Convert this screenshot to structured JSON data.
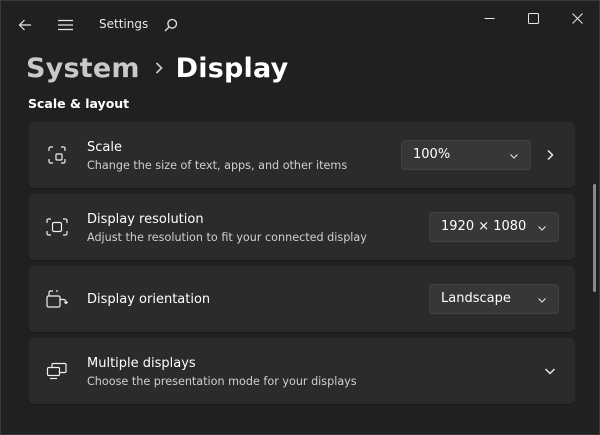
{
  "app": {
    "title": "Settings"
  },
  "breadcrumb": {
    "parent": "System",
    "current": "Display"
  },
  "section": {
    "title": "Scale & layout"
  },
  "cards": {
    "scale": {
      "title": "Scale",
      "description": "Change the size of text, apps, and other items",
      "value": "100%",
      "icon": "scale-icon"
    },
    "resolution": {
      "title": "Display resolution",
      "description": "Adjust the resolution to fit your connected display",
      "value": "1920 × 1080",
      "icon": "resolution-icon"
    },
    "orientation": {
      "title": "Display orientation",
      "value": "Landscape",
      "icon": "orientation-icon"
    },
    "multiple": {
      "title": "Multiple displays",
      "description": "Choose the presentation mode for your displays",
      "icon": "multiple-displays-icon"
    }
  },
  "colors": {
    "background": "#202020",
    "card": "#2b2b2b",
    "dropdown": "#373737",
    "text": "#ffffff",
    "subtext": "#cfcfcf"
  }
}
